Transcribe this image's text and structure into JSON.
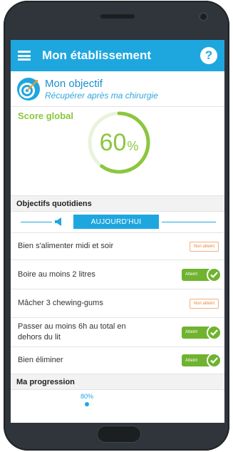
{
  "header": {
    "title": "Mon établissement",
    "help_label": "?"
  },
  "objective": {
    "title": "Mon objectif",
    "subtitle": "Récupérer après ma chirurgie"
  },
  "score": {
    "label": "Score global",
    "value": "60",
    "unit": "%",
    "progress": 0.6,
    "color": "#8cc63e"
  },
  "daily": {
    "section_title": "Objectifs quotidiens",
    "day_button": "AUJOURD'HUI",
    "items": [
      {
        "label": "Bien s'alimenter midi et soir",
        "status": "Non atteint"
      },
      {
        "label": "Boire au moins 2 litres",
        "status": "Atteint"
      },
      {
        "label": "Mâcher 3 chewing-gums",
        "status": "Non atteint"
      },
      {
        "label": "Passer au moins 6h au total en dehors du lit",
        "status": "Atteint"
      },
      {
        "label": "Bien éliminer",
        "status": "Atteint"
      }
    ]
  },
  "progression": {
    "section_title": "Ma progression",
    "value": "80%"
  },
  "colors": {
    "accent": "#1ea7df",
    "success": "#6fb32f",
    "warning": "#e9843a"
  }
}
